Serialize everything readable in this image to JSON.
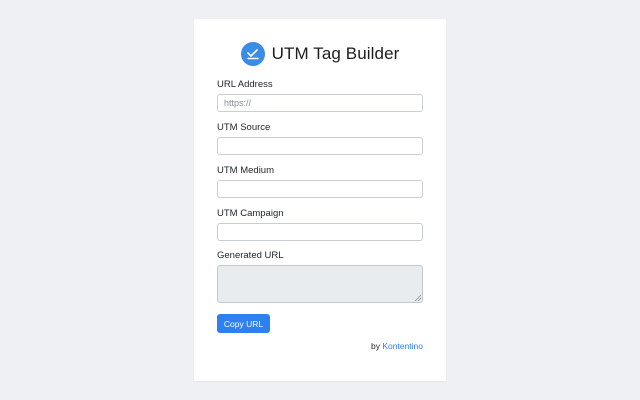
{
  "app": {
    "title": "UTM Tag Builder",
    "logo_icon": "chart-check-icon",
    "accent_color": "#2e7ff0"
  },
  "form": {
    "url": {
      "label": "URL Address",
      "value": "",
      "placeholder": "https://"
    },
    "source": {
      "label": "UTM Source",
      "value": "",
      "placeholder": ""
    },
    "medium": {
      "label": "UTM Medium",
      "value": "",
      "placeholder": ""
    },
    "campaign": {
      "label": "UTM Campaign",
      "value": "",
      "placeholder": ""
    },
    "generated": {
      "label": "Generated URL",
      "value": ""
    }
  },
  "actions": {
    "copy_label": "Copy URL"
  },
  "footer": {
    "prefix": "by",
    "link_text": "Kontentino"
  }
}
